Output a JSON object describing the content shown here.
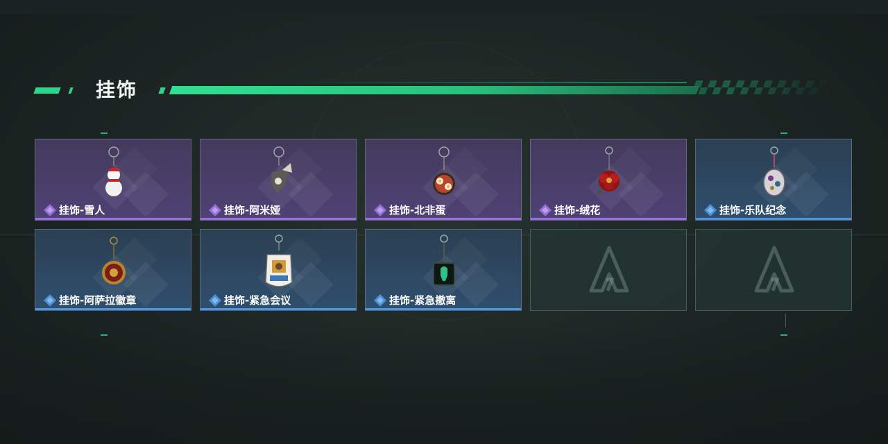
{
  "section": {
    "title": "挂饰"
  },
  "colors": {
    "accent": "#2fd48c",
    "rarity_purple": "#9a6fe0",
    "rarity_blue": "#4a95de"
  },
  "items": [
    {
      "name": "挂饰-雪人",
      "rarity": "purple",
      "icon": "snowman-charm-icon"
    },
    {
      "name": "挂饰-阿米娅",
      "rarity": "purple",
      "icon": "amiya-charm-icon"
    },
    {
      "name": "挂饰-北非蛋",
      "rarity": "purple",
      "icon": "shakshuka-charm-icon"
    },
    {
      "name": "挂饰-绒花",
      "rarity": "purple",
      "icon": "velvet-flower-charm-icon"
    },
    {
      "name": "挂饰-乐队纪念",
      "rarity": "blue",
      "icon": "band-badge-charm-icon"
    },
    {
      "name": "挂饰-阿萨拉徽章",
      "rarity": "blue",
      "icon": "asala-emblem-charm-icon"
    },
    {
      "name": "挂饰-紧急会议",
      "rarity": "blue",
      "icon": "emergency-meeting-charm-icon"
    },
    {
      "name": "挂饰-紧急撤离",
      "rarity": "blue",
      "icon": "emergency-evac-charm-icon"
    }
  ],
  "empty_slots": 2
}
